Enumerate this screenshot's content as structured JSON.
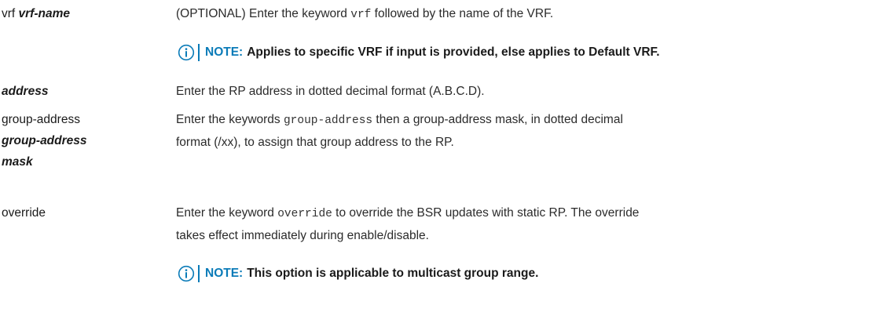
{
  "rows": [
    {
      "term_kw": "vrf",
      "term_var": "vrf-name",
      "def_pre": "(OPTIONAL) Enter the keyword ",
      "def_code": "vrf",
      "def_post": " followed by the name of the VRF."
    },
    {
      "term_var": "address",
      "def": "Enter the RP address in dotted decimal format (A.B.C.D)."
    },
    {
      "term_kw": "group-address",
      "term_var_line1": "group-address",
      "term_var_line2": "mask",
      "def_pre": "Enter the keywords ",
      "def_code": "group-address",
      "def_post_line1": " then a group-address mask, in dotted decimal",
      "def_line2": "format (/xx), to assign that group address to the RP."
    },
    {
      "term_kw": "override",
      "def_pre": "Enter the keyword ",
      "def_code": "override",
      "def_post_line1": " to override the BSR updates with static RP. The override",
      "def_line2": "takes effect immediately during enable/disable."
    }
  ],
  "notes": [
    {
      "label": "NOTE:",
      "text": "Applies to specific VRF if input is provided, else applies to Default VRF."
    },
    {
      "label": "NOTE:",
      "text": "This option is applicable to multicast group range."
    }
  ],
  "icon": "info-icon",
  "colors": {
    "accent": "#0a7bb8",
    "text": "#1a1a1a"
  }
}
